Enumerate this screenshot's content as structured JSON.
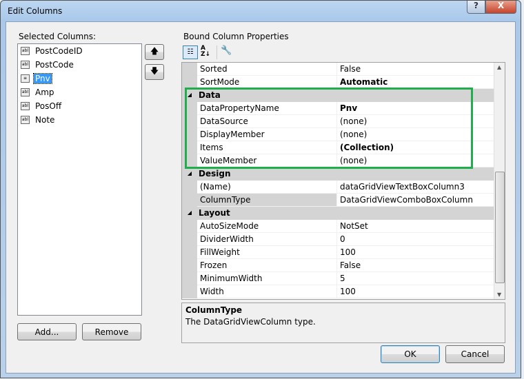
{
  "window": {
    "title": "Edit Columns",
    "help": "?",
    "close": "X"
  },
  "left": {
    "label": "Selected Columns:",
    "items": [
      {
        "label": "PostCodeID",
        "icon": "textbox-column-icon"
      },
      {
        "label": "PostCode",
        "icon": "textbox-column-icon"
      },
      {
        "label": "Pnv",
        "icon": "combobox-column-icon",
        "selected": true
      },
      {
        "label": "Amp",
        "icon": "textbox-column-icon"
      },
      {
        "label": "PosOff",
        "icon": "textbox-column-icon"
      },
      {
        "label": "Note",
        "icon": "textbox-column-icon"
      }
    ],
    "up": "🡅",
    "down": "🡇",
    "add": "Add...",
    "remove": "Remove"
  },
  "props": {
    "label": "Bound Column Properties",
    "rows": [
      {
        "name": "Sorted",
        "value": "False"
      },
      {
        "name": "SortMode",
        "value": "Automatic",
        "bold": true
      },
      {
        "category": "Data"
      },
      {
        "name": "DataPropertyName",
        "value": "Pnv",
        "bold": true
      },
      {
        "name": "DataSource",
        "value": "(none)"
      },
      {
        "name": "DisplayMember",
        "value": "(none)"
      },
      {
        "name": "Items",
        "value": "(Collection)",
        "bold": true
      },
      {
        "name": "ValueMember",
        "value": "(none)"
      },
      {
        "category": "Design"
      },
      {
        "name": "(Name)",
        "value": "dataGridViewTextBoxColumn3"
      },
      {
        "name": "ColumnType",
        "value": "DataGridViewComboBoxColumn",
        "selected": true
      },
      {
        "category": "Layout"
      },
      {
        "name": "AutoSizeMode",
        "value": "NotSet"
      },
      {
        "name": "DividerWidth",
        "value": "0"
      },
      {
        "name": "FillWeight",
        "value": "100"
      },
      {
        "name": "Frozen",
        "value": "False"
      },
      {
        "name": "MinimumWidth",
        "value": "5"
      },
      {
        "name": "Width",
        "value": "100"
      }
    ],
    "desc_title": "ColumnType",
    "desc_text": "The DataGridViewColumn type."
  },
  "footer": {
    "ok": "OK",
    "cancel": "Cancel"
  },
  "highlight_color": "#1fae4b"
}
